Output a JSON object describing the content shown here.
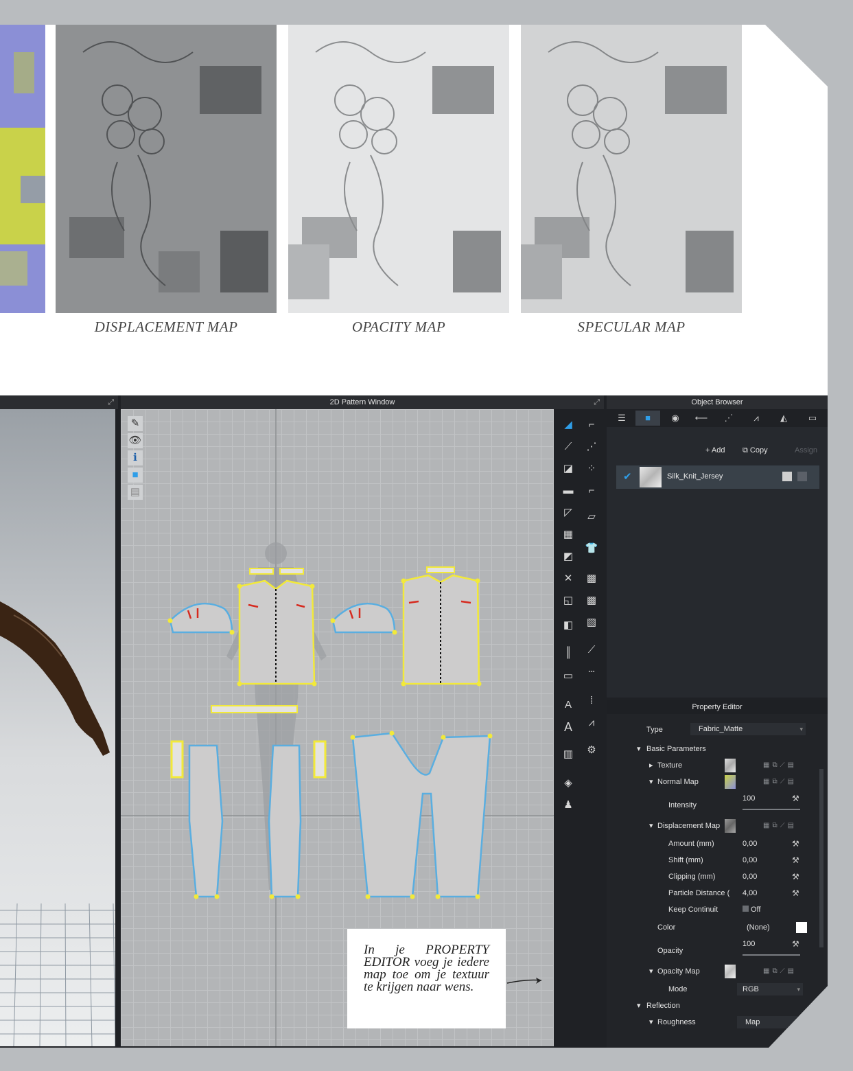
{
  "maps": {
    "captions": [
      "DISPLACEMENT MAP",
      "OPACITY MAP",
      "SPECULAR MAP"
    ]
  },
  "pattern_window": {
    "title": "2D Pattern Window"
  },
  "object_browser": {
    "title": "Object Browser",
    "buttons": {
      "add": "+ Add",
      "copy": "Copy",
      "assign": "Assign"
    },
    "fabric_name": "Silk_Knit_Jersey"
  },
  "property_editor": {
    "title": "Property Editor",
    "type_label": "Type",
    "type_value": "Fabric_Matte",
    "basic_parameters": "Basic Parameters",
    "texture": "Texture",
    "normal_map": "Normal Map",
    "intensity_label": "Intensity",
    "intensity_value": "100",
    "displacement_map": "Displacement Map",
    "amount_label": "Amount (mm)",
    "amount_value": "0,00",
    "shift_label": "Shift (mm)",
    "shift_value": "0,00",
    "clipping_label": "Clipping (mm)",
    "clipping_value": "0,00",
    "particle_label": "Particle Distance (",
    "particle_value": "4,00",
    "keep_label": "Keep Continuit",
    "keep_value": "Off",
    "color_label": "Color",
    "color_value": "(None)",
    "opacity_label": "Opacity",
    "opacity_value": "100",
    "opacity_map": "Opacity Map",
    "mode_label": "Mode",
    "mode_value": "RGB",
    "reflection": "Reflection",
    "roughness": "Roughness",
    "roughness_value": "Map"
  },
  "note": "In je PROPERTY EDITOR voeg je iedere map toe om je textuur te krijgen naar wens.",
  "colors": {
    "accent_blue": "#2f9ee8",
    "pattern_yellow": "#f2e93a",
    "pattern_outline": "#5aaee0"
  }
}
